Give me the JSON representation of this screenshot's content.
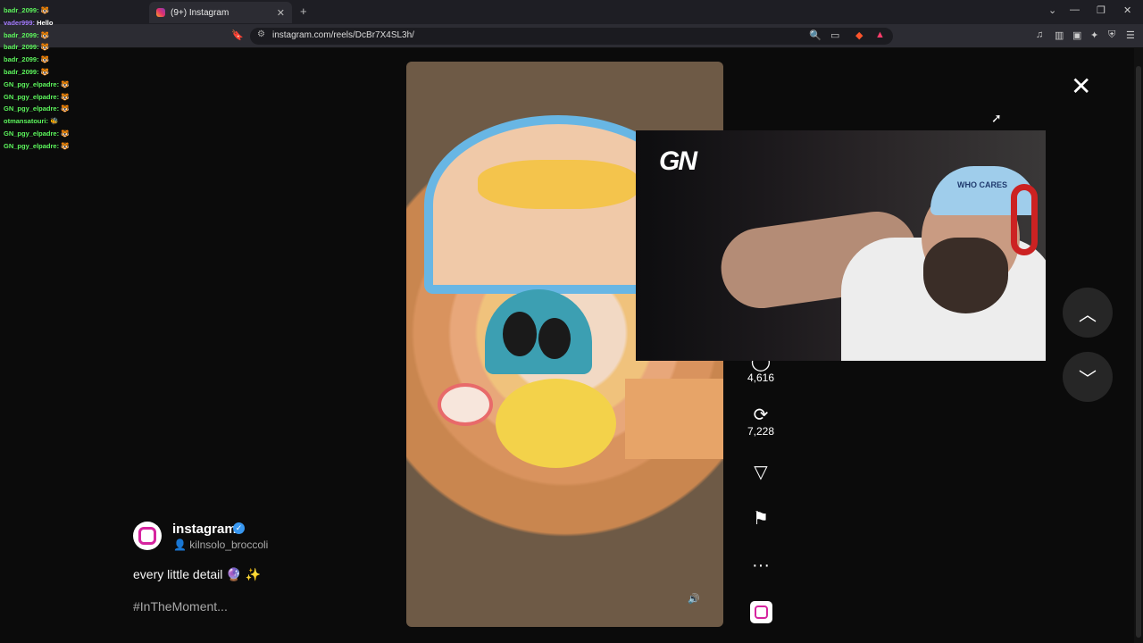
{
  "browser": {
    "tab_title": "(9+) Instagram",
    "tab_close": "✕",
    "new_tab": "+",
    "url": "instagram.com/reels/DcBr7X4SL3h/",
    "controls": {
      "chevron": "⌄",
      "minimize": "—",
      "restore": "❐",
      "close": "✕"
    }
  },
  "chat": [
    {
      "user": "badr_2099:",
      "msg": "🐯",
      "style": "u"
    },
    {
      "user": "vader999:",
      "msg": "Hello",
      "style": "u2"
    },
    {
      "user": "badr_2099:",
      "msg": "🐯",
      "style": "u"
    },
    {
      "user": "badr_2099:",
      "msg": "🐯",
      "style": "u"
    },
    {
      "user": "badr_2099:",
      "msg": "🐯",
      "style": "u"
    },
    {
      "user": "badr_2099:",
      "msg": "🐯",
      "style": "u"
    },
    {
      "user": "GN_pgy_elpadre:",
      "msg": "🐯",
      "style": "u"
    },
    {
      "user": "GN_pgy_elpadre:",
      "msg": "🐯",
      "style": "u"
    },
    {
      "user": "GN_pgy_elpadre:",
      "msg": "🐯",
      "style": "u"
    },
    {
      "user": "otmansatouri:",
      "msg": "🐝",
      "style": "u"
    },
    {
      "user": "GN_pgy_elpadre:",
      "msg": "🐯",
      "style": "u"
    },
    {
      "user": "GN_pgy_elpadre:",
      "msg": "🐯",
      "style": "u"
    }
  ],
  "reel": {
    "author": "instagram",
    "collaborator": "kilnsolo_broccoli",
    "caption": "every little detail 🔮 ✨",
    "tags": "#InTheMoment...",
    "volume_icon": "🔊"
  },
  "overlay": {
    "logo": "GN",
    "cap_text": "WHO CARES"
  },
  "actions": {
    "comments_count": "4,616",
    "reposts_count": "7,228",
    "more": "···"
  },
  "nav": {
    "close": "✕",
    "up": "︿",
    "down": "﹀"
  }
}
